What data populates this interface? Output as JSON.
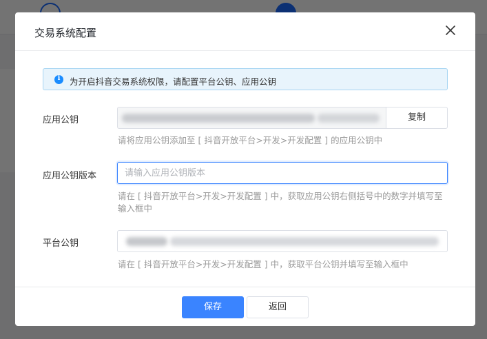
{
  "modal": {
    "title": "交易系统配置",
    "alert_text": "为开启抖音交易系统权限，请配置平台公钥、应用公钥"
  },
  "app_public_key": {
    "label": "应用公钥",
    "copy_label": "复制",
    "hint": "请将应用公钥添加至 [ 抖音开放平台>开发>开发配置 ] 的应用公钥中"
  },
  "app_key_version": {
    "label": "应用公钥版本",
    "value": "",
    "placeholder": "请输入应用公钥版本",
    "hint": "请在 [ 抖音开放平台>开发>开发配置 ] 中，获取应用公钥右侧括号中的数字并填写至输入框中"
  },
  "platform_public_key": {
    "label": "平台公钥",
    "hint": "请在 [ 抖音开放平台>开发>开发配置 ] 中，获取平台公钥并填写至输入框中"
  },
  "footer": {
    "save_label": "保存",
    "back_label": "返回"
  },
  "colors": {
    "primary": "#3a84ff",
    "alert_bg": "#e8f4fc",
    "alert_border": "#a5d4f2",
    "hint_text": "#999999"
  },
  "icons": {
    "close": "close-icon",
    "alert": "info-icon"
  }
}
